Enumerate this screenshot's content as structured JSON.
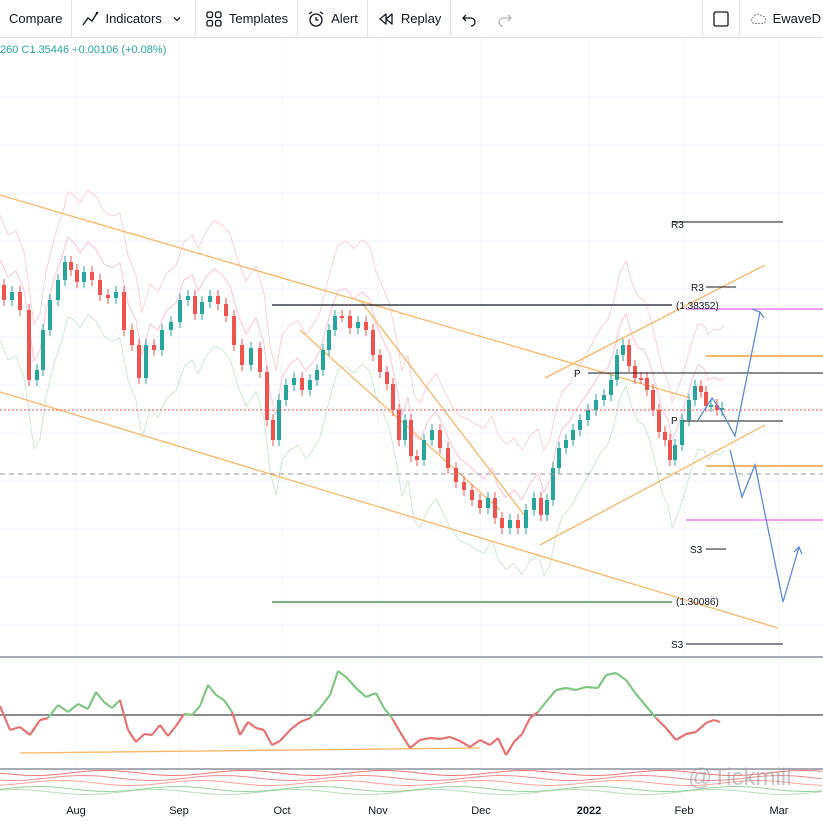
{
  "toolbar": {
    "compare_label": "Compare",
    "indicators_label": "Indicators",
    "templates_label": "Templates",
    "alert_label": "Alert",
    "replay_label": "Replay",
    "account_label": "EwaveD"
  },
  "legend": {
    "text": "260  C1.35446  +0.00106 (+0.08%)"
  },
  "chart_labels": {
    "r3_upper": "R3",
    "r3_lower": "R3",
    "level_high": "(1.38352)",
    "pivot_upper": "P",
    "pivot_lower": "P",
    "s3_upper": "S3",
    "s3_lower": "S3",
    "level_low": "(1.30086)"
  },
  "watermark": "@Tickmill",
  "colors": {
    "bull": "#26a69a",
    "bear": "#ef5350",
    "trendline": "#f5b76a",
    "rsi_up": "#81c784",
    "rsi_down": "#e57373",
    "projection": "#5b8ad8"
  },
  "time_axis": [
    "Aug",
    "Sep",
    "Oct",
    "Nov",
    "Dec",
    "2022",
    "Feb",
    "Mar"
  ]
}
